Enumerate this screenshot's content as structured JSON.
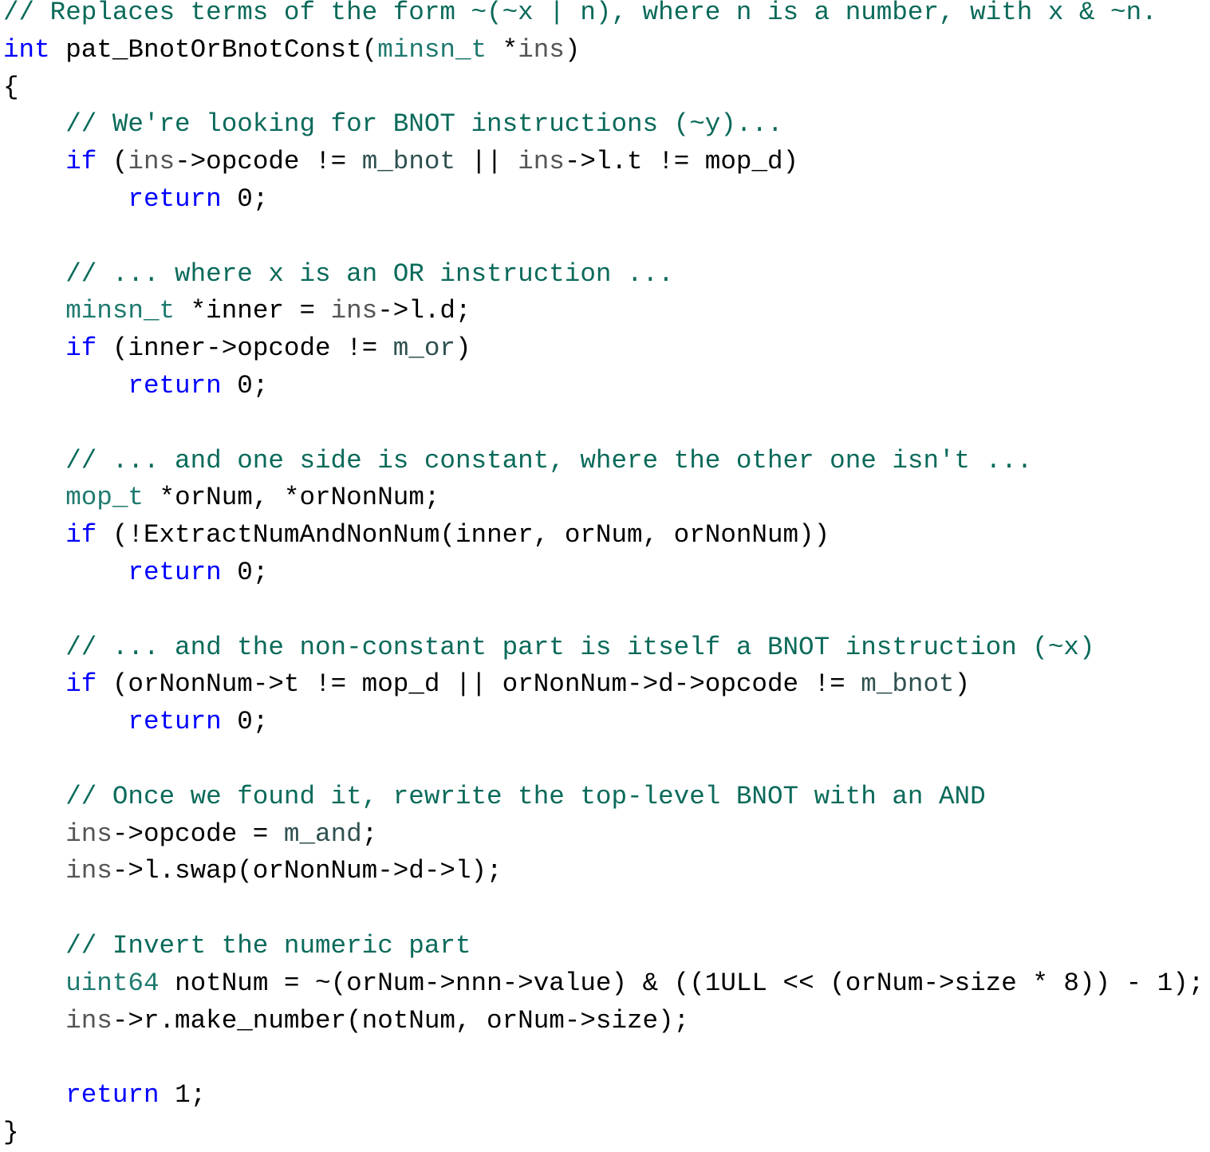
{
  "colors": {
    "comment": "#0a6a5a",
    "keyword": "#0000ff",
    "type": "#1f7a6e",
    "param": "#555555",
    "enum": "#2f5050",
    "plain": "#000000"
  },
  "lines": [
    {
      "tokens": [
        {
          "c": "comment",
          "text": "// Replaces terms of the form ~(~x | n), where n is a number, with x & ~n."
        }
      ]
    },
    {
      "tokens": [
        {
          "c": "keyword",
          "text": "int"
        },
        {
          "c": "plain",
          "text": " pat_BnotOrBnotConst("
        },
        {
          "c": "type",
          "text": "minsn_t"
        },
        {
          "c": "plain",
          "text": " *"
        },
        {
          "c": "param",
          "text": "ins"
        },
        {
          "c": "plain",
          "text": ")"
        }
      ]
    },
    {
      "tokens": [
        {
          "c": "plain",
          "text": "{"
        }
      ]
    },
    {
      "tokens": [
        {
          "c": "plain",
          "text": "    "
        },
        {
          "c": "comment",
          "text": "// We're looking for BNOT instructions (~y)..."
        }
      ]
    },
    {
      "tokens": [
        {
          "c": "plain",
          "text": "    "
        },
        {
          "c": "keyword",
          "text": "if"
        },
        {
          "c": "plain",
          "text": " ("
        },
        {
          "c": "param",
          "text": "ins"
        },
        {
          "c": "plain",
          "text": "->opcode != "
        },
        {
          "c": "enum",
          "text": "m_bnot"
        },
        {
          "c": "plain",
          "text": " || "
        },
        {
          "c": "param",
          "text": "ins"
        },
        {
          "c": "plain",
          "text": "->l.t != mop_d)"
        }
      ]
    },
    {
      "tokens": [
        {
          "c": "plain",
          "text": "        "
        },
        {
          "c": "keyword",
          "text": "return"
        },
        {
          "c": "plain",
          "text": " 0;"
        }
      ]
    },
    {
      "tokens": []
    },
    {
      "tokens": [
        {
          "c": "plain",
          "text": "    "
        },
        {
          "c": "comment",
          "text": "// ... where x is an OR instruction ..."
        }
      ]
    },
    {
      "tokens": [
        {
          "c": "plain",
          "text": "    "
        },
        {
          "c": "type",
          "text": "minsn_t"
        },
        {
          "c": "plain",
          "text": " *inner = "
        },
        {
          "c": "param",
          "text": "ins"
        },
        {
          "c": "plain",
          "text": "->l.d;"
        }
      ]
    },
    {
      "tokens": [
        {
          "c": "plain",
          "text": "    "
        },
        {
          "c": "keyword",
          "text": "if"
        },
        {
          "c": "plain",
          "text": " (inner->opcode != "
        },
        {
          "c": "enum",
          "text": "m_or"
        },
        {
          "c": "plain",
          "text": ")"
        }
      ]
    },
    {
      "tokens": [
        {
          "c": "plain",
          "text": "        "
        },
        {
          "c": "keyword",
          "text": "return"
        },
        {
          "c": "plain",
          "text": " 0;"
        }
      ]
    },
    {
      "tokens": []
    },
    {
      "tokens": [
        {
          "c": "plain",
          "text": "    "
        },
        {
          "c": "comment",
          "text": "// ... and one side is constant, where the other one isn't ..."
        }
      ]
    },
    {
      "tokens": [
        {
          "c": "plain",
          "text": "    "
        },
        {
          "c": "type",
          "text": "mop_t"
        },
        {
          "c": "plain",
          "text": " *orNum, *orNonNum;"
        }
      ]
    },
    {
      "tokens": [
        {
          "c": "plain",
          "text": "    "
        },
        {
          "c": "keyword",
          "text": "if"
        },
        {
          "c": "plain",
          "text": " (!ExtractNumAndNonNum(inner, orNum, orNonNum))"
        }
      ]
    },
    {
      "tokens": [
        {
          "c": "plain",
          "text": "        "
        },
        {
          "c": "keyword",
          "text": "return"
        },
        {
          "c": "plain",
          "text": " 0;"
        }
      ]
    },
    {
      "tokens": []
    },
    {
      "tokens": [
        {
          "c": "plain",
          "text": "    "
        },
        {
          "c": "comment",
          "text": "// ... and the non-constant part is itself a BNOT instruction (~x)"
        }
      ]
    },
    {
      "tokens": [
        {
          "c": "plain",
          "text": "    "
        },
        {
          "c": "keyword",
          "text": "if"
        },
        {
          "c": "plain",
          "text": " (orNonNum->t != mop_d || orNonNum->d->opcode != "
        },
        {
          "c": "enum",
          "text": "m_bnot"
        },
        {
          "c": "plain",
          "text": ")"
        }
      ]
    },
    {
      "tokens": [
        {
          "c": "plain",
          "text": "        "
        },
        {
          "c": "keyword",
          "text": "return"
        },
        {
          "c": "plain",
          "text": " 0;"
        }
      ]
    },
    {
      "tokens": []
    },
    {
      "tokens": [
        {
          "c": "plain",
          "text": "    "
        },
        {
          "c": "comment",
          "text": "// Once we found it, rewrite the top-level BNOT with an AND"
        }
      ]
    },
    {
      "tokens": [
        {
          "c": "plain",
          "text": "    "
        },
        {
          "c": "param",
          "text": "ins"
        },
        {
          "c": "plain",
          "text": "->opcode = "
        },
        {
          "c": "enum",
          "text": "m_and"
        },
        {
          "c": "plain",
          "text": ";"
        }
      ]
    },
    {
      "tokens": [
        {
          "c": "plain",
          "text": "    "
        },
        {
          "c": "param",
          "text": "ins"
        },
        {
          "c": "plain",
          "text": "->l.swap(orNonNum->d->l);"
        }
      ]
    },
    {
      "tokens": []
    },
    {
      "tokens": [
        {
          "c": "plain",
          "text": "    "
        },
        {
          "c": "comment",
          "text": "// Invert the numeric part"
        }
      ]
    },
    {
      "tokens": [
        {
          "c": "plain",
          "text": "    "
        },
        {
          "c": "type",
          "text": "uint64"
        },
        {
          "c": "plain",
          "text": " notNum = ~(orNum->nnn->value) & ((1ULL << (orNum->size * 8)) - 1);"
        }
      ]
    },
    {
      "tokens": [
        {
          "c": "plain",
          "text": "    "
        },
        {
          "c": "param",
          "text": "ins"
        },
        {
          "c": "plain",
          "text": "->r.make_number(notNum, orNum->size);"
        }
      ]
    },
    {
      "tokens": []
    },
    {
      "tokens": [
        {
          "c": "plain",
          "text": "    "
        },
        {
          "c": "keyword",
          "text": "return"
        },
        {
          "c": "plain",
          "text": " 1;"
        }
      ]
    },
    {
      "tokens": [
        {
          "c": "plain",
          "text": "}"
        }
      ]
    }
  ]
}
